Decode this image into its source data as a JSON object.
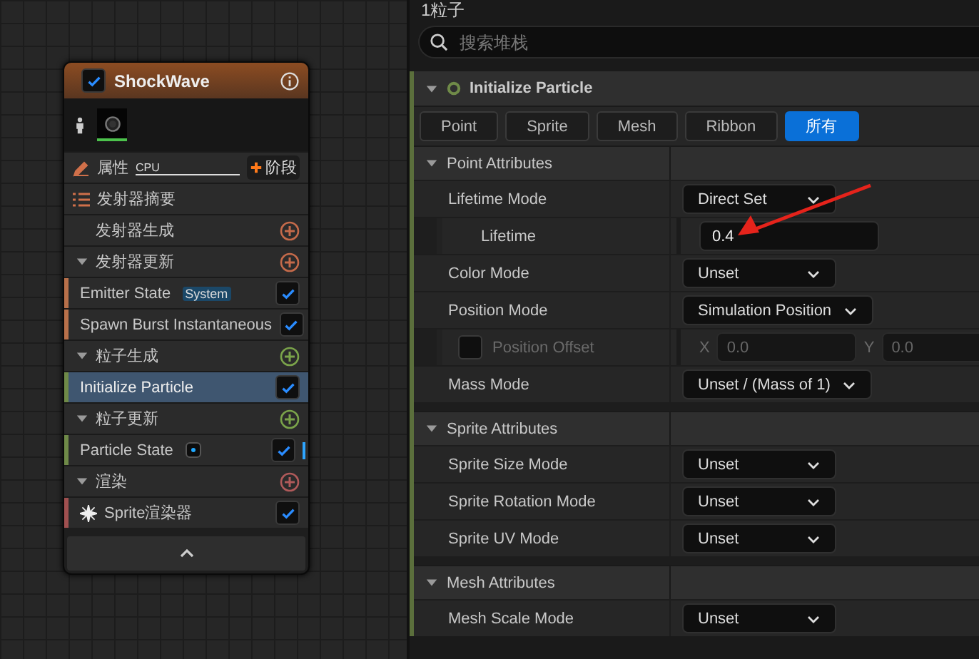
{
  "graph_node": {
    "title": "ShockWave",
    "enabled": true,
    "properties_label": "属性",
    "sim_target": "CPU",
    "add_stage_button": "阶段",
    "summary_label": "发射器摘要",
    "items": [
      {
        "kind": "group-leaf",
        "label": "发射器生成",
        "color": "#c46a4a"
      },
      {
        "kind": "group",
        "label": "发射器更新",
        "expanded": true,
        "color": "#c46a4a"
      },
      {
        "kind": "module",
        "label": "Emitter State",
        "tag": "System",
        "color": "#b8704a",
        "checked": true,
        "selected": false
      },
      {
        "kind": "module",
        "label": "Spawn Burst Instantaneous",
        "color": "#b8704a",
        "checked": true,
        "selected": false
      },
      {
        "kind": "group",
        "label": "粒子生成",
        "expanded": true,
        "color": "#7aa34a"
      },
      {
        "kind": "module",
        "label": "Initialize Particle",
        "color": "#6f8a48",
        "checked": true,
        "selected": true
      },
      {
        "kind": "group",
        "label": "粒子更新",
        "expanded": true,
        "color": "#7aa34a"
      },
      {
        "kind": "state-module",
        "label": "Particle State",
        "color": "#6f8a48",
        "checked": true,
        "selected": false
      },
      {
        "kind": "group",
        "label": "渲染",
        "expanded": true,
        "color": "#b05a5a"
      },
      {
        "kind": "renderer",
        "label": "Sprite渲染器",
        "color": "#a05050",
        "checked": true,
        "selected": false
      }
    ]
  },
  "panel": {
    "title": "1粒子",
    "search": {
      "placeholder": "搜索堆栈"
    },
    "module": {
      "title": "Initialize Particle",
      "expanded": true,
      "filters": [
        {
          "label": "Point",
          "selected": false
        },
        {
          "label": "Sprite",
          "selected": false
        },
        {
          "label": "Mesh",
          "selected": false
        },
        {
          "label": "Ribbon",
          "selected": false
        },
        {
          "label": "所有",
          "selected": true
        }
      ],
      "sections": [
        {
          "title": "Point Attributes",
          "expanded": true,
          "rows": [
            {
              "kind": "dropdown",
              "label": "Lifetime Mode",
              "value": "Direct Set"
            },
            {
              "kind": "number",
              "label": "Lifetime",
              "value": "0.4"
            },
            {
              "kind": "dropdown",
              "label": "Color Mode",
              "value": "Unset"
            },
            {
              "kind": "dropdown",
              "label": "Position Mode",
              "value": "Simulation Position"
            },
            {
              "kind": "vector",
              "label": "Position Offset",
              "checked": false,
              "components": [
                {
                  "axis": "X",
                  "value": "0.0"
                },
                {
                  "axis": "Y",
                  "value": "0.0"
                }
              ]
            },
            {
              "kind": "dropdown",
              "label": "Mass Mode",
              "value": "Unset / (Mass of 1)"
            }
          ]
        },
        {
          "title": "Sprite Attributes",
          "expanded": true,
          "rows": [
            {
              "kind": "dropdown",
              "label": "Sprite Size Mode",
              "value": "Unset"
            },
            {
              "kind": "dropdown",
              "label": "Sprite Rotation Mode",
              "value": "Unset"
            },
            {
              "kind": "dropdown",
              "label": "Sprite UV Mode",
              "value": "Unset"
            }
          ]
        },
        {
          "title": "Mesh Attributes",
          "expanded": true,
          "rows": [
            {
              "kind": "dropdown",
              "label": "Mesh Scale Mode",
              "value": "Unset"
            }
          ]
        }
      ]
    }
  }
}
